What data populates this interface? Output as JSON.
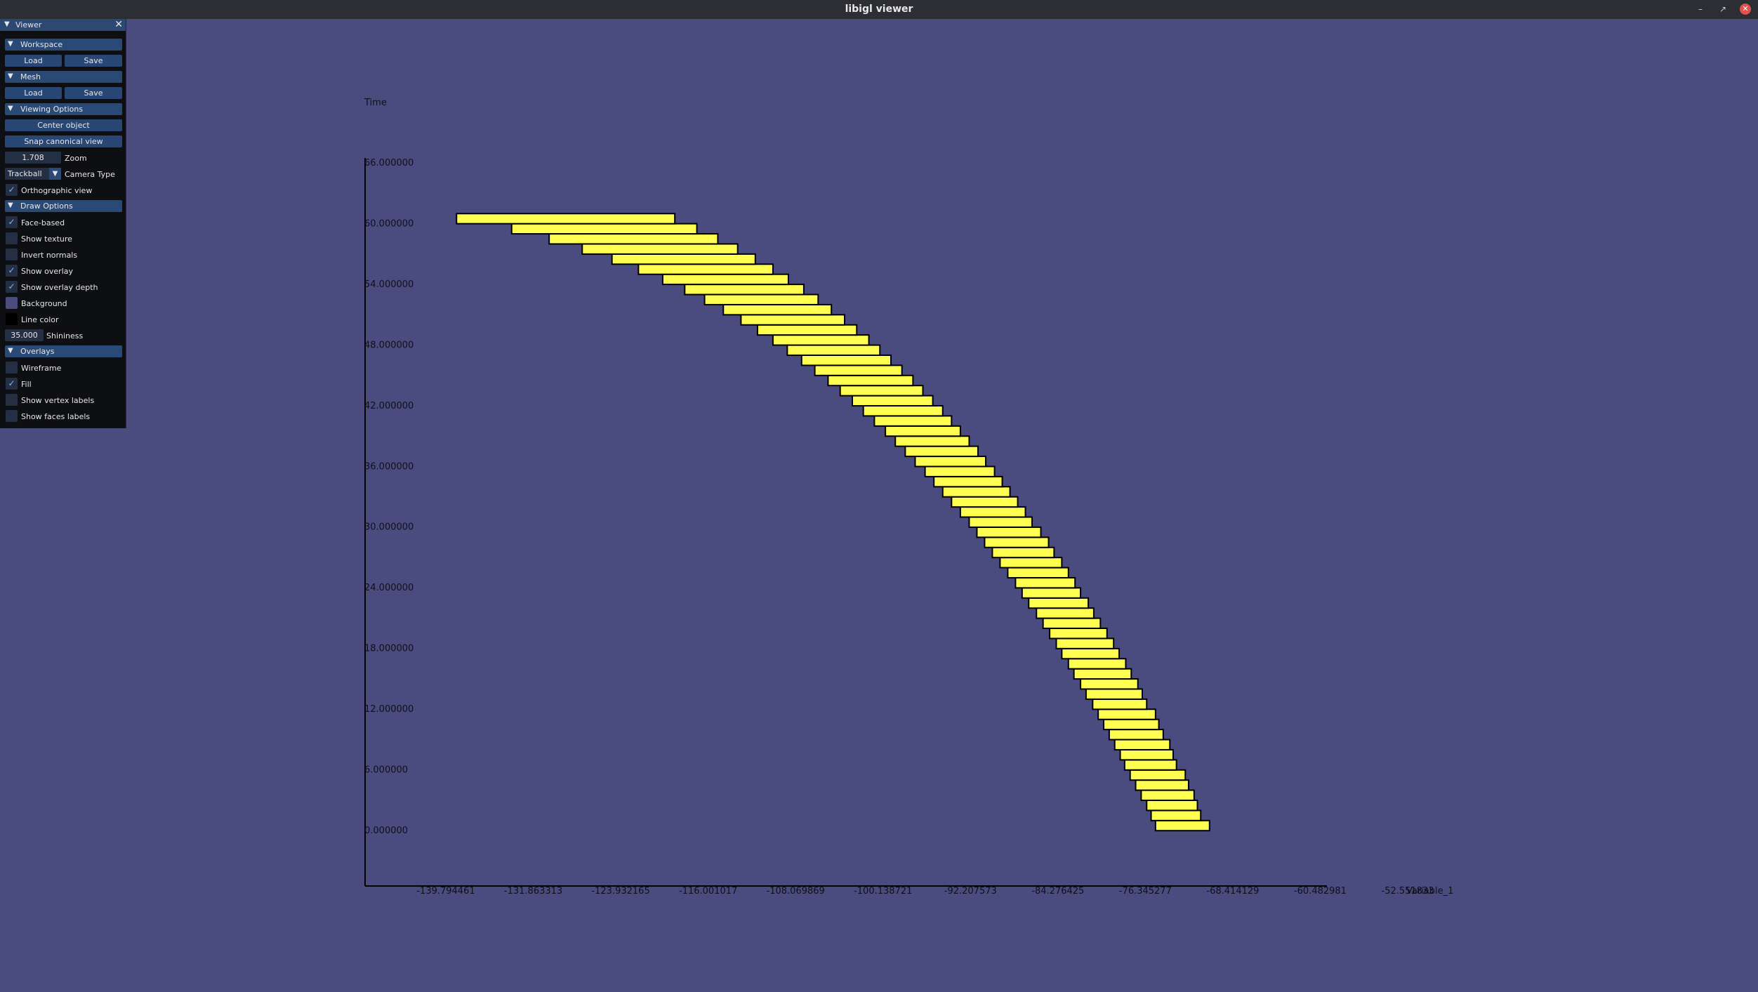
{
  "window": {
    "title": "libigl viewer"
  },
  "panel": {
    "title": "Viewer",
    "workspace": {
      "header": "Workspace",
      "load": "Load",
      "save": "Save"
    },
    "mesh": {
      "header": "Mesh",
      "load": "Load",
      "save": "Save"
    },
    "viewing": {
      "header": "Viewing Options",
      "center": "Center object",
      "snap": "Snap canonical view",
      "zoom_value": "1.708",
      "zoom_label": "Zoom",
      "camera_value": "Trackball",
      "camera_label": "Camera Type",
      "ortho_label": "Orthographic view",
      "ortho_checked": true
    },
    "draw": {
      "header": "Draw Options",
      "items": [
        {
          "label": "Face-based",
          "checked": true
        },
        {
          "label": "Show texture",
          "checked": false
        },
        {
          "label": "Invert normals",
          "checked": false
        },
        {
          "label": "Show overlay",
          "checked": true
        },
        {
          "label": "Show overlay depth",
          "checked": true
        }
      ],
      "background_label": "Background",
      "background_color": "#4a4b7e",
      "linecolor_label": "Line color",
      "line_color": "#000000",
      "shininess_value": "35.000",
      "shininess_label": "Shininess"
    },
    "overlays": {
      "header": "Overlays",
      "items": [
        {
          "label": "Wireframe",
          "checked": false
        },
        {
          "label": "Fill",
          "checked": true
        },
        {
          "label": "Show vertex labels",
          "checked": false
        },
        {
          "label": "Show faces labels",
          "checked": false
        }
      ]
    }
  },
  "chart_data": {
    "type": "bar",
    "ylabel": "Time",
    "xlabel": "Variable_1",
    "y_ticks": [
      "0.000000",
      "6.000000",
      "12.000000",
      "18.000000",
      "24.000000",
      "30.000000",
      "36.000000",
      "42.000000",
      "48.000000",
      "54.000000",
      "60.000000",
      "66.000000"
    ],
    "x_ticks": [
      "-139.794461",
      "-131.863313",
      "-123.932165",
      "-116.001017",
      "-108.069869",
      "-100.138721",
      "-92.207573",
      "-84.276425",
      "-76.345277",
      "-68.414129",
      "-60.482981",
      "-52.551833"
    ],
    "bar_color": "#ffff52",
    "bars": [
      {
        "time": 0,
        "x0": -68.1,
        "x1": -63.2
      },
      {
        "time": 1,
        "x0": -68.5,
        "x1": -64.0
      },
      {
        "time": 2,
        "x0": -68.9,
        "x1": -64.3
      },
      {
        "time": 3,
        "x0": -69.4,
        "x1": -64.6
      },
      {
        "time": 4,
        "x0": -69.9,
        "x1": -65.1
      },
      {
        "time": 5,
        "x0": -70.4,
        "x1": -65.4
      },
      {
        "time": 6,
        "x0": -70.9,
        "x1": -66.2
      },
      {
        "time": 7,
        "x0": -71.3,
        "x1": -66.5
      },
      {
        "time": 8,
        "x0": -71.8,
        "x1": -66.8
      },
      {
        "time": 9,
        "x0": -72.3,
        "x1": -67.4
      },
      {
        "time": 10,
        "x0": -72.8,
        "x1": -67.8
      },
      {
        "time": 11,
        "x0": -73.3,
        "x1": -68.1
      },
      {
        "time": 12,
        "x0": -73.8,
        "x1": -68.9
      },
      {
        "time": 13,
        "x0": -74.4,
        "x1": -69.3
      },
      {
        "time": 14,
        "x0": -74.9,
        "x1": -69.7
      },
      {
        "time": 15,
        "x0": -75.5,
        "x1": -70.3
      },
      {
        "time": 16,
        "x0": -76.0,
        "x1": -70.8
      },
      {
        "time": 17,
        "x0": -76.6,
        "x1": -71.4
      },
      {
        "time": 18,
        "x0": -77.1,
        "x1": -71.9
      },
      {
        "time": 19,
        "x0": -77.7,
        "x1": -72.5
      },
      {
        "time": 20,
        "x0": -78.3,
        "x1": -73.1
      },
      {
        "time": 21,
        "x0": -78.9,
        "x1": -73.7
      },
      {
        "time": 22,
        "x0": -79.6,
        "x1": -74.2
      },
      {
        "time": 23,
        "x0": -80.2,
        "x1": -74.9
      },
      {
        "time": 24,
        "x0": -80.8,
        "x1": -75.4
      },
      {
        "time": 25,
        "x0": -81.5,
        "x1": -76.0
      },
      {
        "time": 26,
        "x0": -82.2,
        "x1": -76.6
      },
      {
        "time": 27,
        "x0": -82.9,
        "x1": -77.3
      },
      {
        "time": 28,
        "x0": -83.6,
        "x1": -77.8
      },
      {
        "time": 29,
        "x0": -84.3,
        "x1": -78.5
      },
      {
        "time": 30,
        "x0": -85.0,
        "x1": -79.3
      },
      {
        "time": 31,
        "x0": -85.8,
        "x1": -79.9
      },
      {
        "time": 32,
        "x0": -86.6,
        "x1": -80.6
      },
      {
        "time": 33,
        "x0": -87.4,
        "x1": -81.3
      },
      {
        "time": 34,
        "x0": -88.2,
        "x1": -82.0
      },
      {
        "time": 35,
        "x0": -89.0,
        "x1": -82.7
      },
      {
        "time": 36,
        "x0": -89.9,
        "x1": -83.5
      },
      {
        "time": 37,
        "x0": -90.8,
        "x1": -84.2
      },
      {
        "time": 38,
        "x0": -91.7,
        "x1": -85.0
      },
      {
        "time": 39,
        "x0": -92.6,
        "x1": -85.8
      },
      {
        "time": 40,
        "x0": -93.6,
        "x1": -86.6
      },
      {
        "time": 41,
        "x0": -94.6,
        "x1": -87.4
      },
      {
        "time": 42,
        "x0": -95.6,
        "x1": -88.3
      },
      {
        "time": 43,
        "x0": -96.7,
        "x1": -89.2
      },
      {
        "time": 44,
        "x0": -97.8,
        "x1": -90.1
      },
      {
        "time": 45,
        "x0": -99.0,
        "x1": -91.1
      },
      {
        "time": 46,
        "x0": -100.2,
        "x1": -92.1
      },
      {
        "time": 47,
        "x0": -101.5,
        "x1": -93.1
      },
      {
        "time": 48,
        "x0": -102.8,
        "x1": -94.1
      },
      {
        "time": 49,
        "x0": -104.2,
        "x1": -95.2
      },
      {
        "time": 50,
        "x0": -105.7,
        "x1": -96.3
      },
      {
        "time": 51,
        "x0": -107.3,
        "x1": -97.5
      },
      {
        "time": 52,
        "x0": -109.0,
        "x1": -98.7
      },
      {
        "time": 53,
        "x0": -110.8,
        "x1": -100.0
      },
      {
        "time": 54,
        "x0": -112.8,
        "x1": -101.4
      },
      {
        "time": 55,
        "x0": -115.0,
        "x1": -102.8
      },
      {
        "time": 56,
        "x0": -117.4,
        "x1": -104.4
      },
      {
        "time": 57,
        "x0": -120.1,
        "x1": -106.0
      },
      {
        "time": 58,
        "x0": -123.1,
        "x1": -107.8
      },
      {
        "time": 59,
        "x0": -126.5,
        "x1": -109.7
      },
      {
        "time": 60,
        "x0": -131.5,
        "x1": -111.7
      }
    ],
    "ylim": [
      0,
      66
    ],
    "xlim": [
      -139.794461,
      -52.551833
    ]
  }
}
